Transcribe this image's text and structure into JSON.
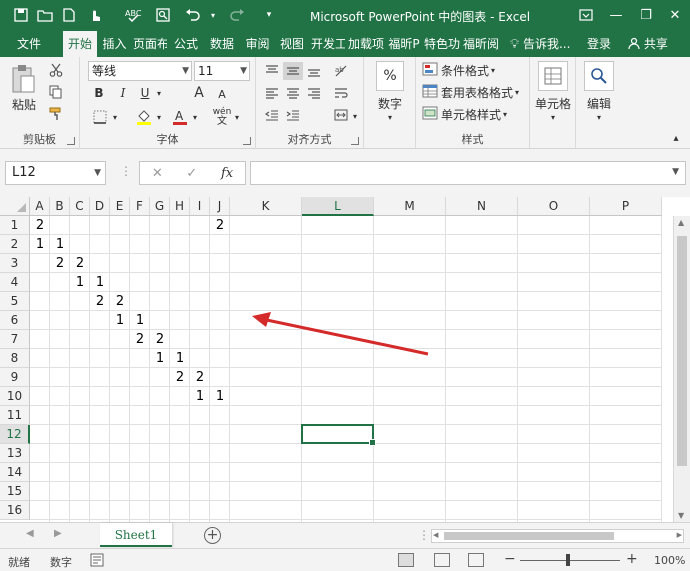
{
  "window": {
    "title": "Microsoft PowerPoint 中的图表 - Excel",
    "min": "—",
    "restore": "❐",
    "close": "✕"
  },
  "tabs": {
    "items": [
      "文件",
      "开始",
      "插入",
      "页面布",
      "公式",
      "数据",
      "审阅",
      "视图",
      "开发工",
      "加载项",
      "福昕P",
      "特色功",
      "福昕阅"
    ],
    "active": "开始",
    "tell_me": "告诉我...",
    "login": "登录",
    "share": "共享"
  },
  "ribbon": {
    "clipboard": {
      "paste": "粘贴",
      "label": "剪贴板"
    },
    "font": {
      "name": "等线",
      "size": "11",
      "label": "字体",
      "bold": "B",
      "italic": "I",
      "underline": "U",
      "grow": "A",
      "shrink": "A",
      "fill_text": "",
      "font_color_letter": "A",
      "wen": "wén"
    },
    "alignment": {
      "label": "对齐方式"
    },
    "number": {
      "percent": "%",
      "label": "数字"
    },
    "styles": {
      "conditional": "条件格式",
      "table": "套用表格格式",
      "cell_styles": "单元格样式",
      "label": "样式"
    },
    "cells": {
      "label": "单元格"
    },
    "editing": {
      "label": "编辑"
    }
  },
  "formula_bar": {
    "name_box": "L12",
    "cancel": "✕",
    "enter": "✓",
    "fx": "fx",
    "content": ""
  },
  "sheet": {
    "columns": [
      "A",
      "B",
      "C",
      "D",
      "E",
      "F",
      "G",
      "H",
      "I",
      "J",
      "K",
      "L",
      "M",
      "N",
      "O",
      "P"
    ],
    "rows": [
      "1",
      "2",
      "3",
      "4",
      "5",
      "6",
      "7",
      "8",
      "9",
      "10",
      "11",
      "12",
      "13",
      "14",
      "15",
      "16"
    ],
    "selected_cell": "L12",
    "cells": [
      {
        "ref": "A1",
        "v": "2"
      },
      {
        "ref": "J1",
        "v": "2"
      },
      {
        "ref": "A2",
        "v": "1"
      },
      {
        "ref": "B2",
        "v": "1"
      },
      {
        "ref": "B3",
        "v": "2"
      },
      {
        "ref": "C3",
        "v": "2"
      },
      {
        "ref": "C4",
        "v": "1"
      },
      {
        "ref": "D4",
        "v": "1"
      },
      {
        "ref": "D5",
        "v": "2"
      },
      {
        "ref": "E5",
        "v": "2"
      },
      {
        "ref": "E6",
        "v": "1"
      },
      {
        "ref": "F6",
        "v": "1"
      },
      {
        "ref": "F7",
        "v": "2"
      },
      {
        "ref": "G7",
        "v": "2"
      },
      {
        "ref": "G8",
        "v": "1"
      },
      {
        "ref": "H8",
        "v": "1"
      },
      {
        "ref": "H9",
        "v": "2"
      },
      {
        "ref": "I9",
        "v": "2"
      },
      {
        "ref": "I10",
        "v": "1"
      },
      {
        "ref": "J10",
        "v": "1"
      }
    ],
    "annotation_arrow_color": "#d42a2a"
  },
  "sheet_tabs": {
    "items": [
      "Sheet1"
    ],
    "add": "+"
  },
  "status": {
    "ready": "就绪",
    "numeric": "数字",
    "zoom": "100%",
    "minus": "−",
    "plus": "+"
  },
  "colors": {
    "brand": "#217346",
    "arrow": "#d42a2a"
  }
}
